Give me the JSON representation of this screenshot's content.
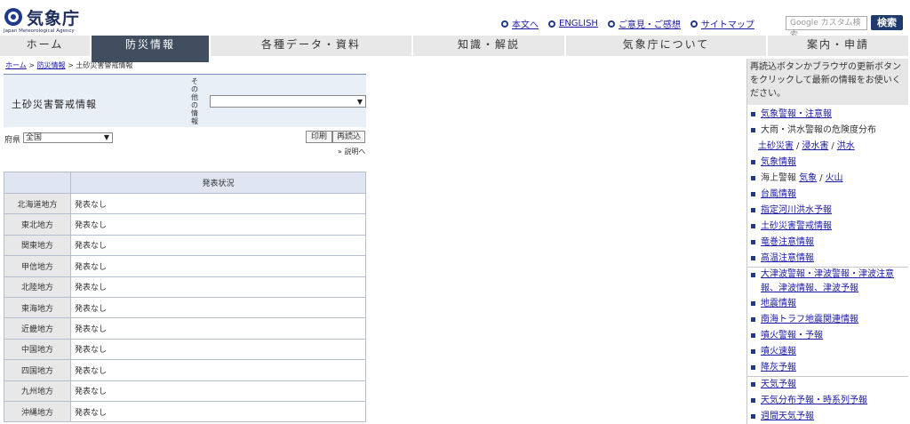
{
  "header": {
    "logo_text": "気象庁",
    "logo_sub": "Japan Meteorological Agency",
    "links": [
      "本文へ",
      "ENGLISH",
      "ご意見・ご感想",
      "サイトマップ"
    ],
    "search_placeholder": "Google カスタム検索",
    "search_button": "検索"
  },
  "nav": [
    "ホーム",
    "防災情報",
    "各種データ・資料",
    "知識・解説",
    "気象庁について",
    "案内・申請"
  ],
  "breadcrumb": {
    "home": "ホーム",
    "sep1": ">",
    "disaster": "防災情報",
    "sep2": ">",
    "current": "土砂災害警戒情報"
  },
  "title": "土砂災害警戒情報",
  "other_label": "その他の情報",
  "pref_label": "府県",
  "pref_value": "全国",
  "print_button": "印刷",
  "reload_button": "再読込",
  "explain_link": "» 説明へ",
  "table": {
    "header": "発表状況",
    "rows": [
      {
        "region": "北海道地方",
        "status": "発表なし"
      },
      {
        "region": "東北地方",
        "status": "発表なし"
      },
      {
        "region": "関東地方",
        "status": "発表なし"
      },
      {
        "region": "甲信地方",
        "status": "発表なし"
      },
      {
        "region": "北陸地方",
        "status": "発表なし"
      },
      {
        "region": "東海地方",
        "status": "発表なし"
      },
      {
        "region": "近畿地方",
        "status": "発表なし"
      },
      {
        "region": "中国地方",
        "status": "発表なし"
      },
      {
        "region": "四国地方",
        "status": "発表なし"
      },
      {
        "region": "九州地方",
        "status": "発表なし"
      },
      {
        "region": "沖縄地方",
        "status": "発表なし"
      }
    ]
  },
  "sidebar": {
    "note": "再読込ボタンかブラウザの更新ボタンをクリックして最新の情報をお使いください。",
    "items": {
      "warnings": "気象警報・注意報",
      "risk_dist": "大雨・洪水警報の危険度分布",
      "landslide": "土砂災害",
      "inundation": "浸水害",
      "flood": "洪水",
      "weather_info": "気象情報",
      "marine_label": "海上警報",
      "marine_weather": "気象",
      "marine_volcano": "火山",
      "typhoon": "台風情報",
      "river_flood": "指定河川洪水予報",
      "landslide_alert": "土砂災害警戒情報",
      "tornado": "竜巻注意情報",
      "heat": "高温注意情報",
      "tsunami": "大津波警報・津波警報・津波注意報、津波情報、津波予報",
      "earthquake": "地震情報",
      "nankai": "南海トラフ地震関連情報",
      "volcano_warn": "噴火警報・予報",
      "volcano_flash": "噴火速報",
      "ashfall": "降灰予報",
      "forecast": "天気予報",
      "dist_forecast": "天気分布予報・時系列予報",
      "weekly": "週間天気予報"
    }
  },
  "colors": {
    "nav_active": "#414e60",
    "link": "#1a1aa6",
    "accent": "#1f3a8c"
  }
}
